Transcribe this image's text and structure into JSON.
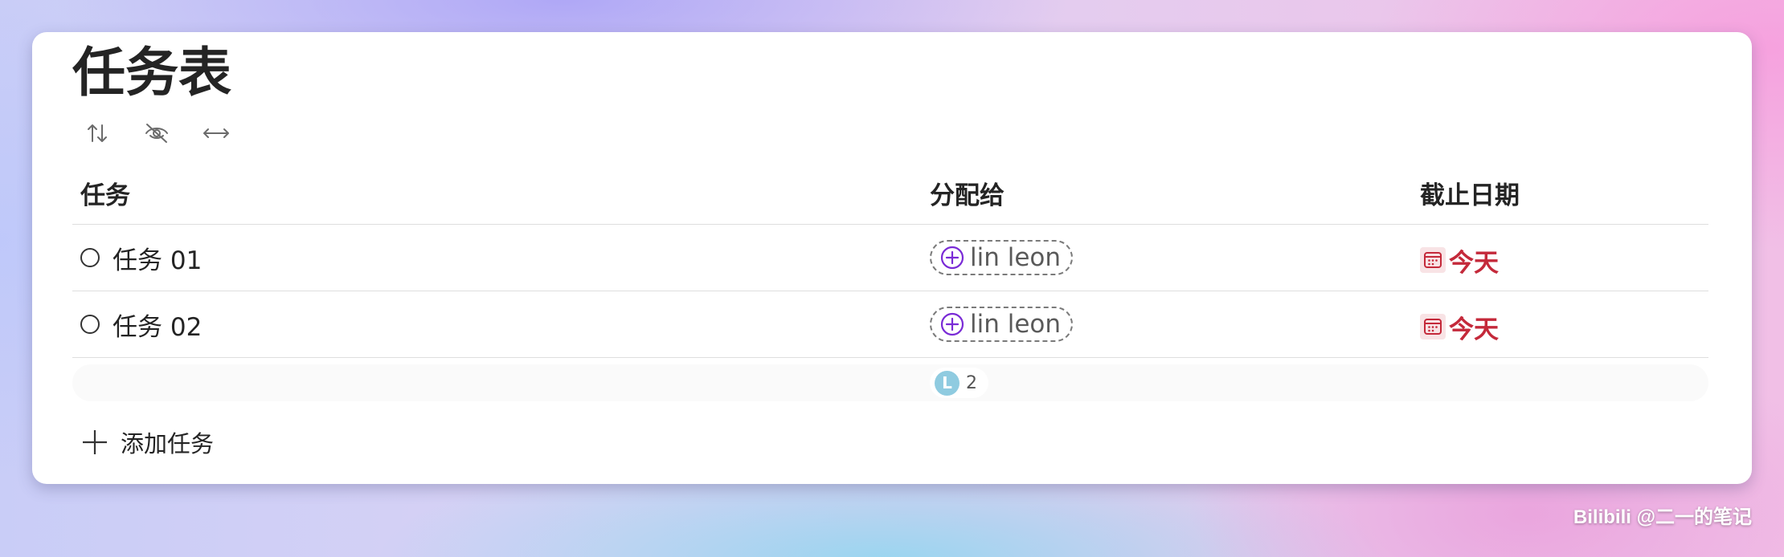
{
  "page": {
    "title": "任务表"
  },
  "toolbar": {
    "icons": [
      "sort-icon",
      "hide-icon",
      "resize-columns-icon"
    ]
  },
  "table": {
    "columns": [
      "任务",
      "分配给",
      "截止日期"
    ],
    "rows": [
      {
        "task": "任务 01",
        "assignee": "lin leon",
        "due": "今天"
      },
      {
        "task": "任务 02",
        "assignee": "lin leon",
        "due": "今天"
      }
    ]
  },
  "summary": {
    "avatar_initial": "L",
    "count": "2"
  },
  "add_task": {
    "label": "添加任务"
  },
  "watermark": "Bilibili @二一的笔记",
  "colors": {
    "accent_purple": "#7a2bd6",
    "due_red": "#c4293a",
    "avatar_blue": "#8fcbe0"
  }
}
